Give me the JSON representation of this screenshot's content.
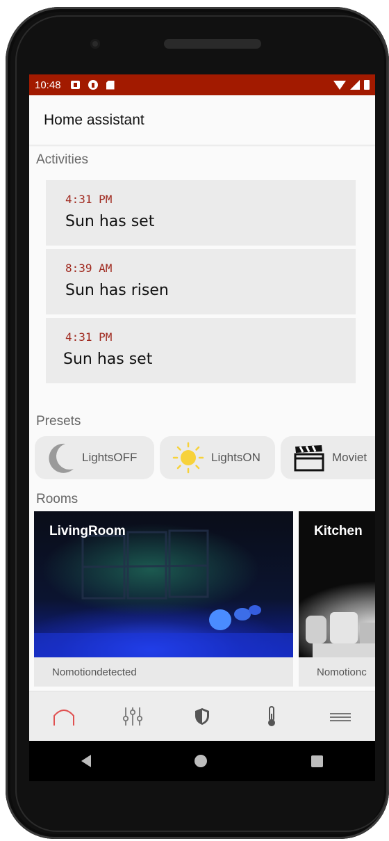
{
  "statusbar": {
    "time": "10:48",
    "color": "#a21a00"
  },
  "appbar": {
    "title": "Home assistant"
  },
  "activities": {
    "label": "Activities",
    "items": [
      {
        "time": "4:31 PM",
        "title": "Sun has set"
      },
      {
        "time": "8:39 AM",
        "title": "Sun has risen"
      },
      {
        "time": "4:31 PM",
        "title": "Sun has set"
      }
    ]
  },
  "presets": {
    "label": "Presets",
    "items": [
      {
        "label": "LightsOFF",
        "icon": "moon-icon"
      },
      {
        "label": "LightsON",
        "icon": "sun-icon"
      },
      {
        "label": "Moviet",
        "icon": "clapperboard-icon"
      }
    ]
  },
  "rooms": {
    "label": "Rooms",
    "items": [
      {
        "name": "LivingRoom",
        "status": "Nomotiondetected"
      },
      {
        "name": "Kitchen",
        "status": "Nomotionc"
      }
    ]
  },
  "bottomnav": {
    "items": [
      "home-icon",
      "sliders-icon",
      "shield-icon",
      "thermometer-icon",
      "menu-icon"
    ],
    "active_color": "#e05050"
  }
}
